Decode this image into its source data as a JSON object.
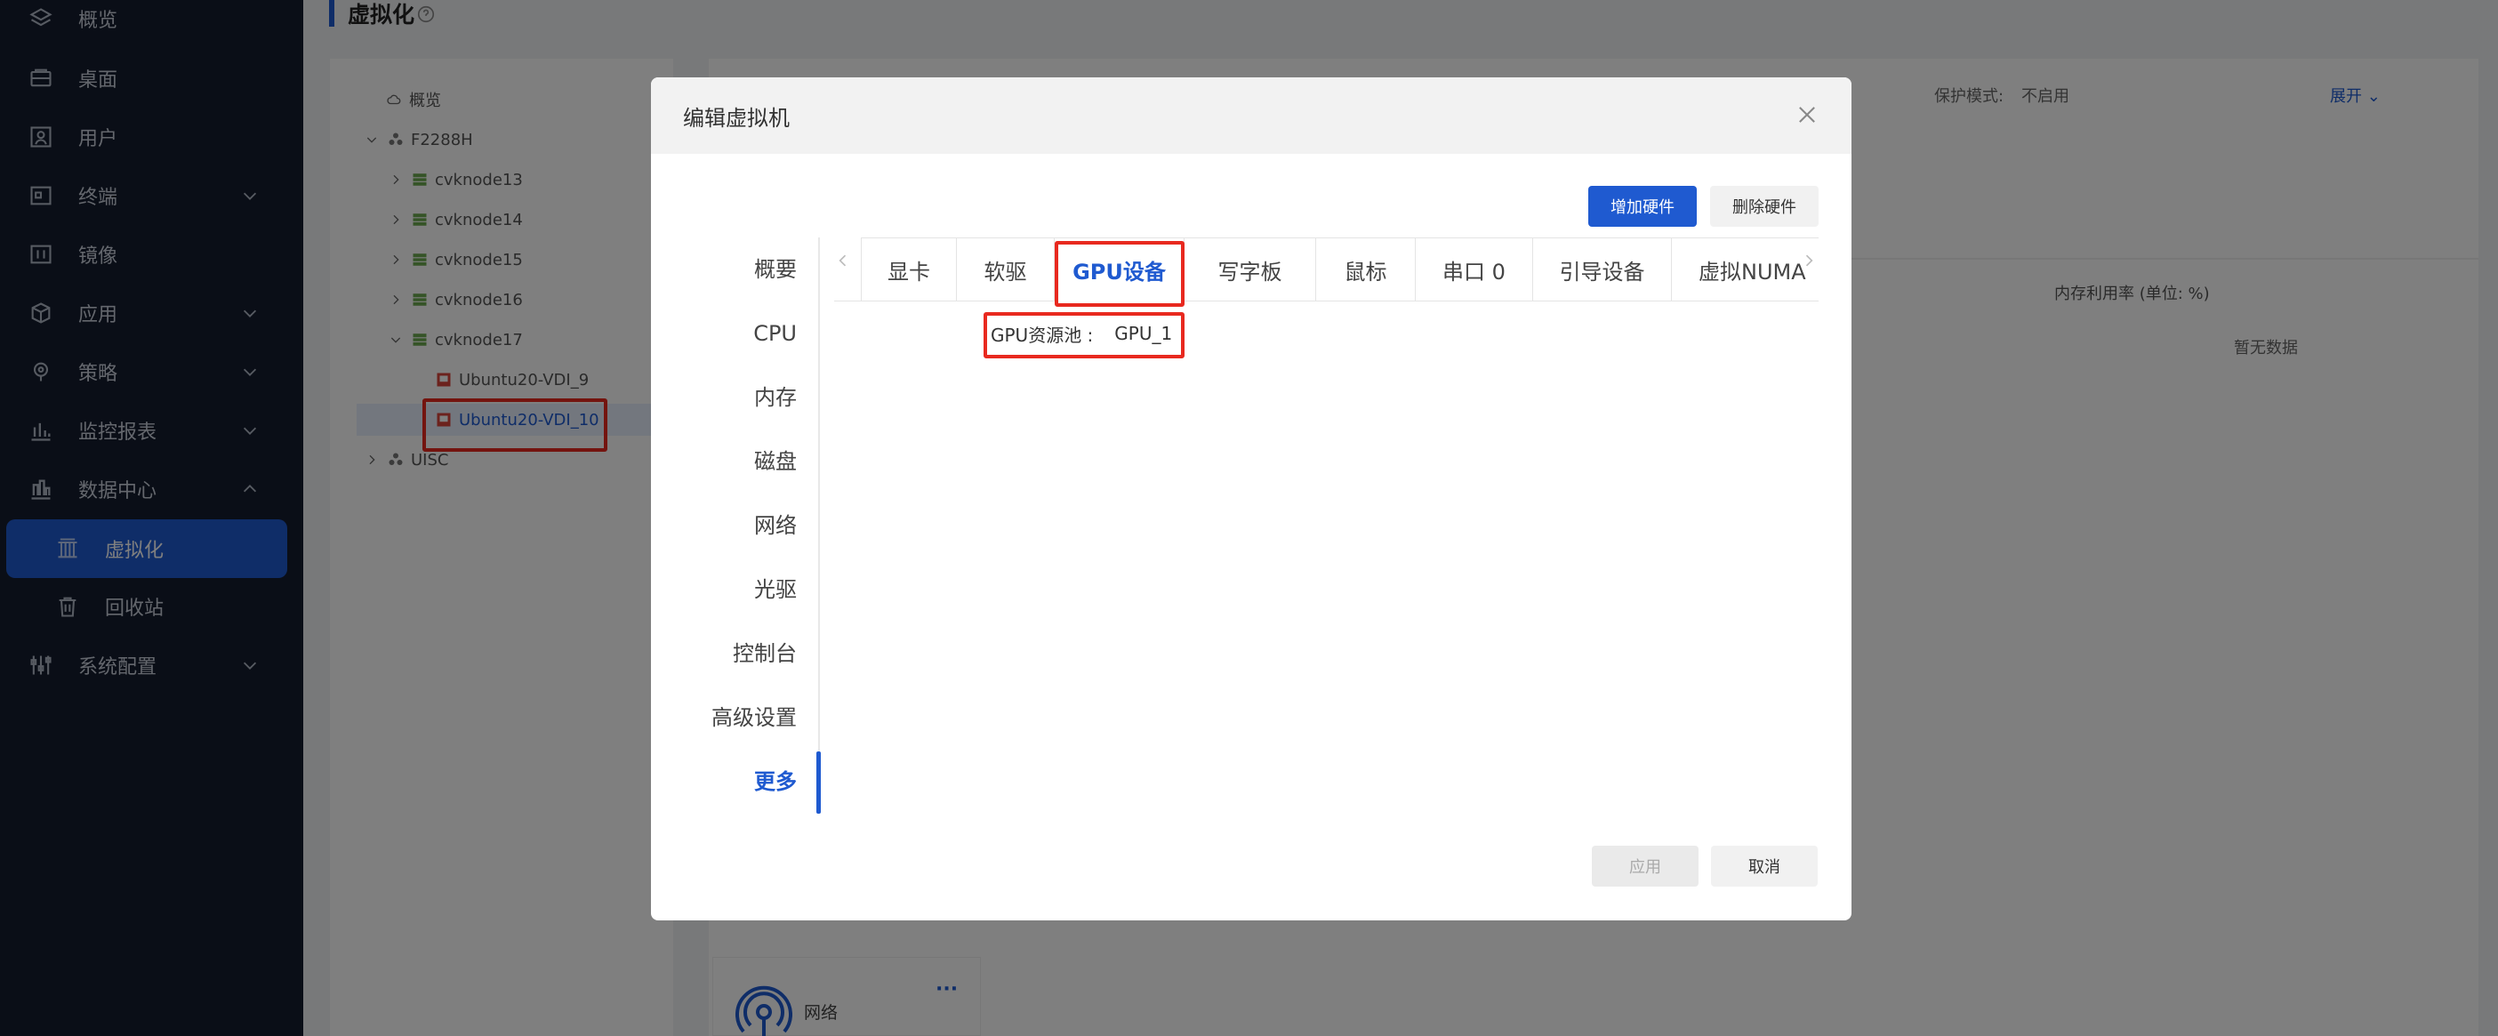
{
  "sidebar": {
    "items": [
      {
        "label": "概览",
        "icon": "layers-icon"
      },
      {
        "label": "桌面",
        "icon": "desktop-icon"
      },
      {
        "label": "用户",
        "icon": "user-icon"
      },
      {
        "label": "终端",
        "icon": "terminal-icon"
      },
      {
        "label": "镜像",
        "icon": "image-icon"
      },
      {
        "label": "应用",
        "icon": "cube-icon"
      },
      {
        "label": "策略",
        "icon": "location-pin-icon"
      },
      {
        "label": "监控报表",
        "icon": "bar-chart-icon"
      },
      {
        "label": "数据中心",
        "icon": "building-chart-icon"
      },
      {
        "label": "虚拟化",
        "icon": "columns-icon"
      },
      {
        "label": "回收站",
        "icon": "trash-icon"
      },
      {
        "label": "系统配置",
        "icon": "sliders-icon"
      }
    ]
  },
  "page": {
    "title": "虚拟化"
  },
  "tree": {
    "items": [
      {
        "label": "概览"
      },
      {
        "label": "F2288H"
      },
      {
        "label": "cvknode13"
      },
      {
        "label": "cvknode14"
      },
      {
        "label": "cvknode15"
      },
      {
        "label": "cvknode16"
      },
      {
        "label": "cvknode17"
      },
      {
        "label": "Ubuntu20-VDI_9"
      },
      {
        "label": "Ubuntu20-VDI_10"
      },
      {
        "label": "UISC"
      }
    ]
  },
  "background": {
    "protect_label": "保护模式:",
    "protect_value": "不启用",
    "expand_label": "展开",
    "mem_header": "内存利用率 (单位: %)",
    "no_data": "暂无数据",
    "card_label": "网络",
    "card_more": "···"
  },
  "modal": {
    "title": "编辑虚拟机",
    "add_hardware": "增加硬件",
    "delete_hardware": "删除硬件",
    "left_nav": [
      "概要",
      "CPU",
      "内存",
      "磁盘",
      "网络",
      "光驱",
      "控制台",
      "高级设置",
      "更多"
    ],
    "tabs": [
      "显卡",
      "软驱",
      "GPU设备",
      "写字板",
      "鼠标",
      "串口 0",
      "引导设备",
      "虚拟NUMA"
    ],
    "gpu_pool_label": "GPU资源池 :",
    "gpu_pool_value": "GPU_1",
    "apply": "应用",
    "cancel": "取消"
  },
  "colors": {
    "sidebar_bg": "#151d2f",
    "accent": "#1f5ad0",
    "highlight": "#e8291f"
  }
}
